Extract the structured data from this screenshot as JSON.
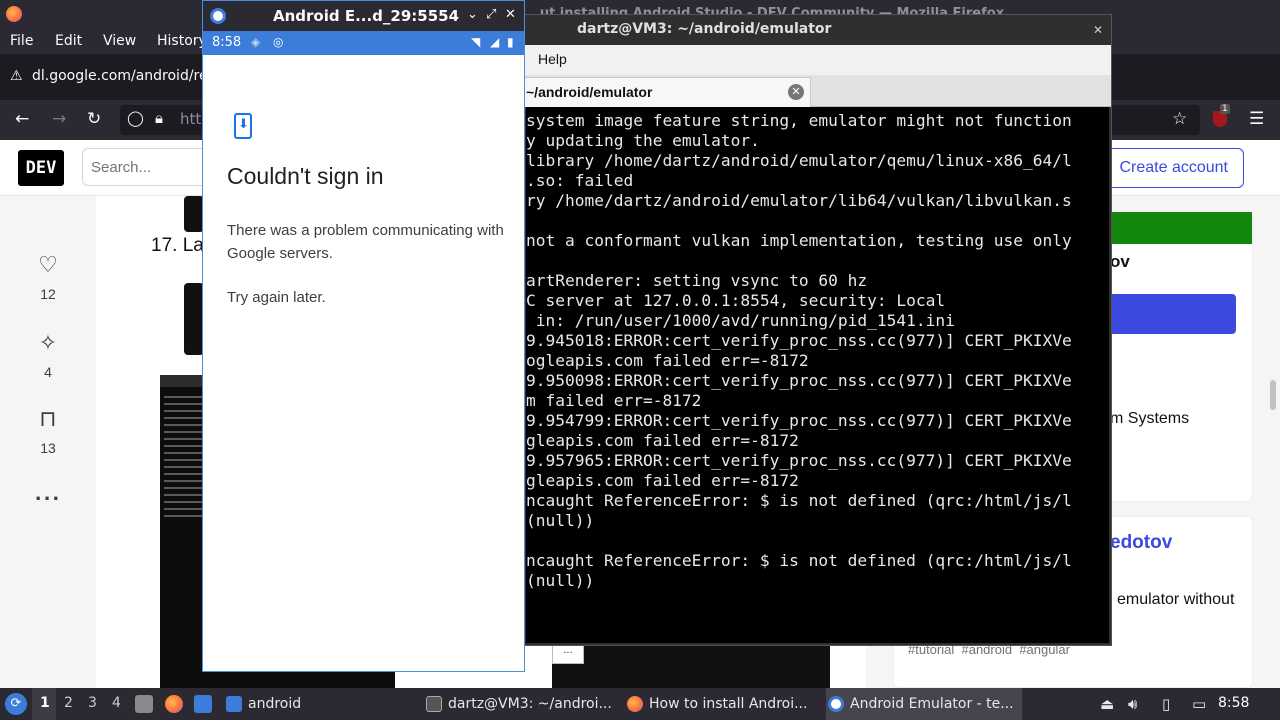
{
  "firefox": {
    "window_title": "...ut installing Android Studio - DEV Community — Mozilla Firefox",
    "menu": [
      "File",
      "Edit",
      "View",
      "History"
    ],
    "tab_url": "dl.google.com/android/re",
    "url_partial": "htt",
    "extension_badge": "1",
    "dev": {
      "logo": "DEV",
      "search_placeholder": "Search...",
      "create_account": "Create account",
      "heading_partial": "17. La",
      "reactions": [
        {
          "icon": "heart-icon",
          "count": "12"
        },
        {
          "icon": "unicorn-icon",
          "count": "4"
        },
        {
          "icon": "bookmark-icon",
          "count": "13"
        }
      ],
      "more": "...",
      "code_corner": "...",
      "side_author_partial": "ov",
      "side_text_systems": "m Systems",
      "side_author2_partial": "edotov",
      "side_text_emulator": "emulator without",
      "tags": [
        "#tutorial",
        "#android",
        "#angular"
      ]
    }
  },
  "terminal": {
    "window_title": "dartz@VM3: ~/android/emulator",
    "menu_help": "Help",
    "tab_label": "~/android/emulator",
    "lines": [
      "system image feature string, emulator might not function",
      "y updating the emulator.",
      "library /home/dartz/android/emulator/qemu/linux-x86_64/l",
      ".so: failed",
      "ry /home/dartz/android/emulator/lib64/vulkan/libvulkan.s",
      "",
      "not a conformant vulkan implementation, testing use only",
      "",
      "artRenderer: setting vsync to 60 hz",
      "C server at 127.0.0.1:8554, security: Local",
      " in: /run/user/1000/avd/running/pid_1541.ini",
      "9.945018:ERROR:cert_verify_proc_nss.cc(977)] CERT_PKIXVe",
      "ogleapis.com failed err=-8172",
      "9.950098:ERROR:cert_verify_proc_nss.cc(977)] CERT_PKIXVe",
      "m failed err=-8172",
      "9.954799:ERROR:cert_verify_proc_nss.cc(977)] CERT_PKIXVe",
      "gleapis.com failed err=-8172",
      "9.957965:ERROR:cert_verify_proc_nss.cc(977)] CERT_PKIXVe",
      "gleapis.com failed err=-8172",
      "ncaught ReferenceError: $ is not defined (qrc:/html/js/l",
      "(null))",
      "",
      "ncaught ReferenceError: $ is not defined (qrc:/html/js/l",
      "(null))"
    ]
  },
  "emulator": {
    "window_title": "Android E...d_29:5554",
    "status_time": "8:58",
    "dialog_title": "Couldn't sign in",
    "dialog_message": "There was a problem communicating with Google servers.",
    "dialog_retry": "Try again later."
  },
  "taskbar": {
    "workspaces": [
      "1",
      "2",
      "3",
      "4"
    ],
    "active_workspace": "1",
    "tasks": [
      {
        "label": "android",
        "icon": "folder-icon"
      },
      {
        "label": "dartz@VM3: ~/androi...",
        "icon": "terminal-icon"
      },
      {
        "label": "How to install Androi...",
        "icon": "firefox-icon"
      },
      {
        "label": "Android Emulator - te...",
        "icon": "android-emulator-icon"
      }
    ],
    "clock": "8:58"
  },
  "colors": {
    "accent_blue": "#3b7dd8",
    "dev_blue": "#3b49df",
    "dev_green": "#12870b",
    "terminal_bg": "#000000"
  }
}
